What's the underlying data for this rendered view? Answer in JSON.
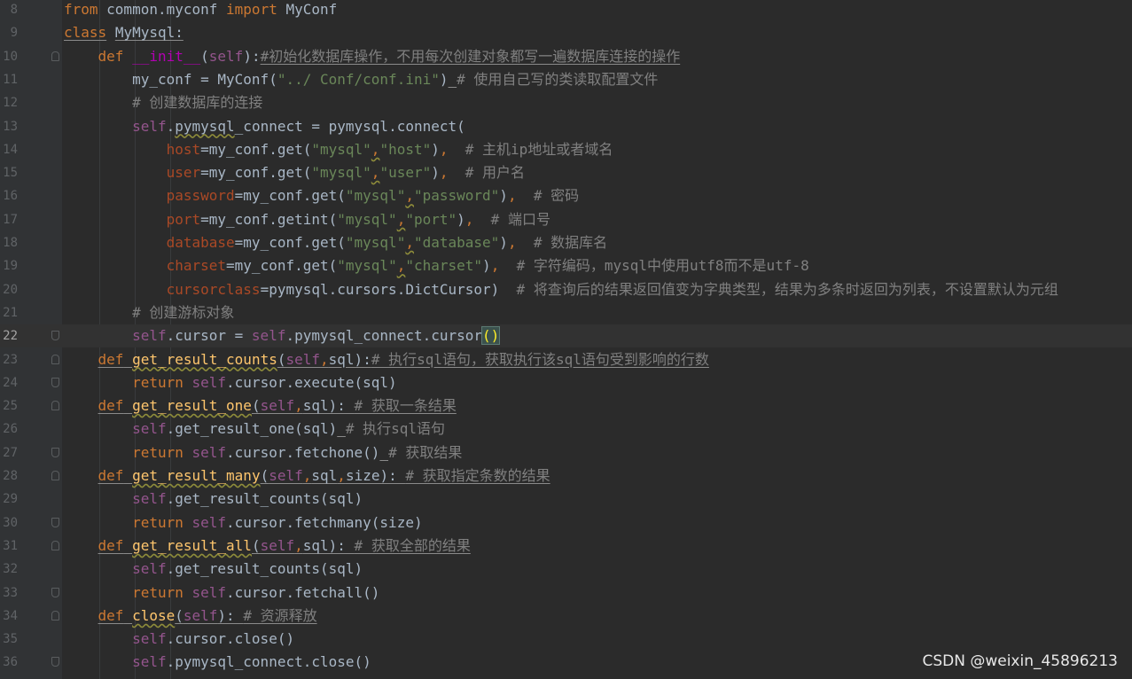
{
  "editor": {
    "current_line": "22",
    "lines": [
      {
        "no": "8",
        "tokens": [
          {
            "t": "from",
            "c": "kw"
          },
          {
            "t": " common.myconf "
          },
          {
            "t": "import",
            "c": "kw"
          },
          {
            "t": " MyConf"
          }
        ]
      },
      {
        "no": "9",
        "tokens": [
          {
            "t": "class",
            "c": "kw ul"
          },
          {
            "t": " "
          },
          {
            "t": "MyMysql:",
            "c": "ul"
          }
        ]
      },
      {
        "no": "10",
        "tokens": [
          {
            "t": "    "
          },
          {
            "t": "def",
            "c": "kw"
          },
          {
            "t": " "
          },
          {
            "t": "__init__",
            "c": "magic"
          },
          {
            "t": "("
          },
          {
            "t": "self",
            "c": "self"
          },
          {
            "t": "):"
          },
          {
            "t": "#初始化数据库操作，不用每次创建对象都写一遍数据库连接的操作",
            "c": "cm ul"
          }
        ]
      },
      {
        "no": "11",
        "tokens": [
          {
            "t": "        my_conf = MyConf("
          },
          {
            "t": "\"../ Conf/conf.ini\"",
            "c": "str"
          },
          {
            "t": ")"
          },
          {
            "t": " ",
            "c": "ul"
          },
          {
            "t": "# 使用自己写的类读取配置文件",
            "c": "cm"
          }
        ]
      },
      {
        "no": "12",
        "tokens": [
          {
            "t": "        "
          },
          {
            "t": "# 创建数据库的连接",
            "c": "cm"
          }
        ]
      },
      {
        "no": "13",
        "tokens": [
          {
            "t": "        "
          },
          {
            "t": "self",
            "c": "self"
          },
          {
            "t": "."
          },
          {
            "t": "pymysql",
            "c": "uw"
          },
          {
            "t": "_connect = pymysql.connect("
          }
        ]
      },
      {
        "no": "14",
        "tokens": [
          {
            "t": "            "
          },
          {
            "t": "host",
            "c": "kwarg"
          },
          {
            "t": "=my_conf.get("
          },
          {
            "t": "\"mysql\"",
            "c": "str"
          },
          {
            "t": ",",
            "c": "kw uw"
          },
          {
            "t": "\"host\"",
            "c": "str"
          },
          {
            "t": ")"
          },
          {
            "t": ",",
            "c": "kw"
          },
          {
            "t": "  "
          },
          {
            "t": "# 主机ip地址或者域名",
            "c": "cm"
          }
        ]
      },
      {
        "no": "15",
        "tokens": [
          {
            "t": "            "
          },
          {
            "t": "user",
            "c": "kwarg"
          },
          {
            "t": "=my_conf.get("
          },
          {
            "t": "\"mysql\"",
            "c": "str"
          },
          {
            "t": ",",
            "c": "kw uw"
          },
          {
            "t": "\"user\"",
            "c": "str"
          },
          {
            "t": ")"
          },
          {
            "t": ",",
            "c": "kw"
          },
          {
            "t": "  "
          },
          {
            "t": "# 用户名",
            "c": "cm"
          }
        ]
      },
      {
        "no": "16",
        "tokens": [
          {
            "t": "            "
          },
          {
            "t": "password",
            "c": "kwarg"
          },
          {
            "t": "=my_conf.get("
          },
          {
            "t": "\"mysql\"",
            "c": "str"
          },
          {
            "t": ",",
            "c": "kw uw"
          },
          {
            "t": "\"password\"",
            "c": "str"
          },
          {
            "t": ")"
          },
          {
            "t": ",",
            "c": "kw"
          },
          {
            "t": "  "
          },
          {
            "t": "# 密码",
            "c": "cm"
          }
        ]
      },
      {
        "no": "17",
        "tokens": [
          {
            "t": "            "
          },
          {
            "t": "port",
            "c": "kwarg"
          },
          {
            "t": "=my_conf.getint("
          },
          {
            "t": "\"mysql\"",
            "c": "str"
          },
          {
            "t": ",",
            "c": "kw uw"
          },
          {
            "t": "\"port\"",
            "c": "str"
          },
          {
            "t": ")"
          },
          {
            "t": ",",
            "c": "kw"
          },
          {
            "t": "  "
          },
          {
            "t": "# 端口号",
            "c": "cm"
          }
        ]
      },
      {
        "no": "18",
        "tokens": [
          {
            "t": "            "
          },
          {
            "t": "database",
            "c": "kwarg"
          },
          {
            "t": "=my_conf.get("
          },
          {
            "t": "\"mysql\"",
            "c": "str"
          },
          {
            "t": ",",
            "c": "kw uw"
          },
          {
            "t": "\"database\"",
            "c": "str"
          },
          {
            "t": ")"
          },
          {
            "t": ",",
            "c": "kw"
          },
          {
            "t": "  "
          },
          {
            "t": "# 数据库名",
            "c": "cm"
          }
        ]
      },
      {
        "no": "19",
        "tokens": [
          {
            "t": "            "
          },
          {
            "t": "charset",
            "c": "kwarg"
          },
          {
            "t": "=my_conf.get("
          },
          {
            "t": "\"mysql\"",
            "c": "str"
          },
          {
            "t": ",",
            "c": "kw uw"
          },
          {
            "t": "\"charset\"",
            "c": "str"
          },
          {
            "t": ")"
          },
          {
            "t": ",",
            "c": "kw"
          },
          {
            "t": "  "
          },
          {
            "t": "# 字符编码，mysql中使用utf8而不是utf-8",
            "c": "cm"
          }
        ]
      },
      {
        "no": "20",
        "tokens": [
          {
            "t": "            "
          },
          {
            "t": "cursorclass",
            "c": "kwarg"
          },
          {
            "t": "=pymysql.cursors.DictCursor)  "
          },
          {
            "t": "# 将查询后的结果返回值变为字典类型，结果为多条时返回为列表，不设置默认为元组",
            "c": "cm"
          }
        ]
      },
      {
        "no": "21",
        "tokens": [
          {
            "t": "        "
          },
          {
            "t": "# 创建游标对象",
            "c": "cm"
          }
        ]
      },
      {
        "no": "22",
        "tokens": [
          {
            "t": "        "
          },
          {
            "t": "self",
            "c": "self"
          },
          {
            "t": ".cursor = "
          },
          {
            "t": "self",
            "c": "self"
          },
          {
            "t": ".pymysql_connect.cursor"
          },
          {
            "t": "()",
            "c": "paren-match"
          }
        ]
      },
      {
        "no": "23",
        "tokens": [
          {
            "t": "    "
          },
          {
            "t": "def",
            "c": "kw ul"
          },
          {
            "t": " ",
            "c": "ul"
          },
          {
            "t": "get_result_counts",
            "c": "fn uw"
          },
          {
            "t": "(",
            "c": "ul"
          },
          {
            "t": "self",
            "c": "self ul"
          },
          {
            "t": ",",
            "c": "kw ul"
          },
          {
            "t": "sql):",
            "c": "ul"
          },
          {
            "t": "# 执行sql语句，获取执行该sql语句受到影响的行数",
            "c": "cm ul"
          }
        ]
      },
      {
        "no": "24",
        "tokens": [
          {
            "t": "        "
          },
          {
            "t": "return",
            "c": "kw"
          },
          {
            "t": " "
          },
          {
            "t": "self",
            "c": "self"
          },
          {
            "t": ".cursor.execute(sql)"
          }
        ]
      },
      {
        "no": "25",
        "tokens": [
          {
            "t": "    "
          },
          {
            "t": "def",
            "c": "kw ul"
          },
          {
            "t": " ",
            "c": "ul"
          },
          {
            "t": "get_result_one",
            "c": "fn uw"
          },
          {
            "t": "(",
            "c": "ul"
          },
          {
            "t": "self",
            "c": "self ul"
          },
          {
            "t": ",",
            "c": "kw ul"
          },
          {
            "t": "sql): ",
            "c": "ul"
          },
          {
            "t": "# 获取一条结果",
            "c": "cm ul"
          }
        ]
      },
      {
        "no": "26",
        "tokens": [
          {
            "t": "        "
          },
          {
            "t": "self",
            "c": "self"
          },
          {
            "t": ".get_result_one(sql)"
          },
          {
            "t": " ",
            "c": "ul"
          },
          {
            "t": "# 执行sql语句",
            "c": "cm"
          }
        ]
      },
      {
        "no": "27",
        "tokens": [
          {
            "t": "        "
          },
          {
            "t": "return",
            "c": "kw"
          },
          {
            "t": " "
          },
          {
            "t": "self",
            "c": "self"
          },
          {
            "t": ".cursor.fetchone()"
          },
          {
            "t": " ",
            "c": "ul"
          },
          {
            "t": "# 获取结果",
            "c": "cm"
          }
        ]
      },
      {
        "no": "28",
        "tokens": [
          {
            "t": "    "
          },
          {
            "t": "def",
            "c": "kw ul"
          },
          {
            "t": " ",
            "c": "ul"
          },
          {
            "t": "get_result_many",
            "c": "fn uw"
          },
          {
            "t": "(",
            "c": "ul"
          },
          {
            "t": "self",
            "c": "self ul"
          },
          {
            "t": ",",
            "c": "kw ul"
          },
          {
            "t": "sql",
            "c": "ul"
          },
          {
            "t": ",",
            "c": "kw ul"
          },
          {
            "t": "size): ",
            "c": "ul"
          },
          {
            "t": "# 获取指定条数的结果",
            "c": "cm ul"
          }
        ]
      },
      {
        "no": "29",
        "tokens": [
          {
            "t": "        "
          },
          {
            "t": "self",
            "c": "self"
          },
          {
            "t": ".get_result_counts(sql)"
          }
        ]
      },
      {
        "no": "30",
        "tokens": [
          {
            "t": "        "
          },
          {
            "t": "return",
            "c": "kw"
          },
          {
            "t": " "
          },
          {
            "t": "self",
            "c": "self"
          },
          {
            "t": ".cursor.fetchmany(size)"
          }
        ]
      },
      {
        "no": "31",
        "tokens": [
          {
            "t": "    "
          },
          {
            "t": "def",
            "c": "kw ul"
          },
          {
            "t": " ",
            "c": "ul"
          },
          {
            "t": "get_result_all",
            "c": "fn uw"
          },
          {
            "t": "(",
            "c": "ul"
          },
          {
            "t": "self",
            "c": "self ul"
          },
          {
            "t": ",",
            "c": "kw ul"
          },
          {
            "t": "sql): ",
            "c": "ul"
          },
          {
            "t": "# 获取全部的结果",
            "c": "cm ul"
          }
        ]
      },
      {
        "no": "32",
        "tokens": [
          {
            "t": "        "
          },
          {
            "t": "self",
            "c": "self"
          },
          {
            "t": ".get_result_counts(sql)"
          }
        ]
      },
      {
        "no": "33",
        "tokens": [
          {
            "t": "        "
          },
          {
            "t": "return",
            "c": "kw"
          },
          {
            "t": " "
          },
          {
            "t": "self",
            "c": "self"
          },
          {
            "t": ".cursor.fetchall()"
          }
        ]
      },
      {
        "no": "34",
        "tokens": [
          {
            "t": "    "
          },
          {
            "t": "def",
            "c": "kw ul"
          },
          {
            "t": " ",
            "c": "ul"
          },
          {
            "t": "close",
            "c": "fn uw"
          },
          {
            "t": "(",
            "c": "ul"
          },
          {
            "t": "self",
            "c": "self ul"
          },
          {
            "t": "): ",
            "c": "ul"
          },
          {
            "t": "# 资源释放",
            "c": "cm ul"
          }
        ]
      },
      {
        "no": "35",
        "tokens": [
          {
            "t": "        "
          },
          {
            "t": "self",
            "c": "self"
          },
          {
            "t": ".cursor.close()"
          }
        ]
      },
      {
        "no": "36",
        "tokens": [
          {
            "t": "        "
          },
          {
            "t": "self",
            "c": "self"
          },
          {
            "t": ".pymysql_connect.close()"
          }
        ]
      }
    ]
  },
  "watermark": "CSDN @weixin_45896213"
}
